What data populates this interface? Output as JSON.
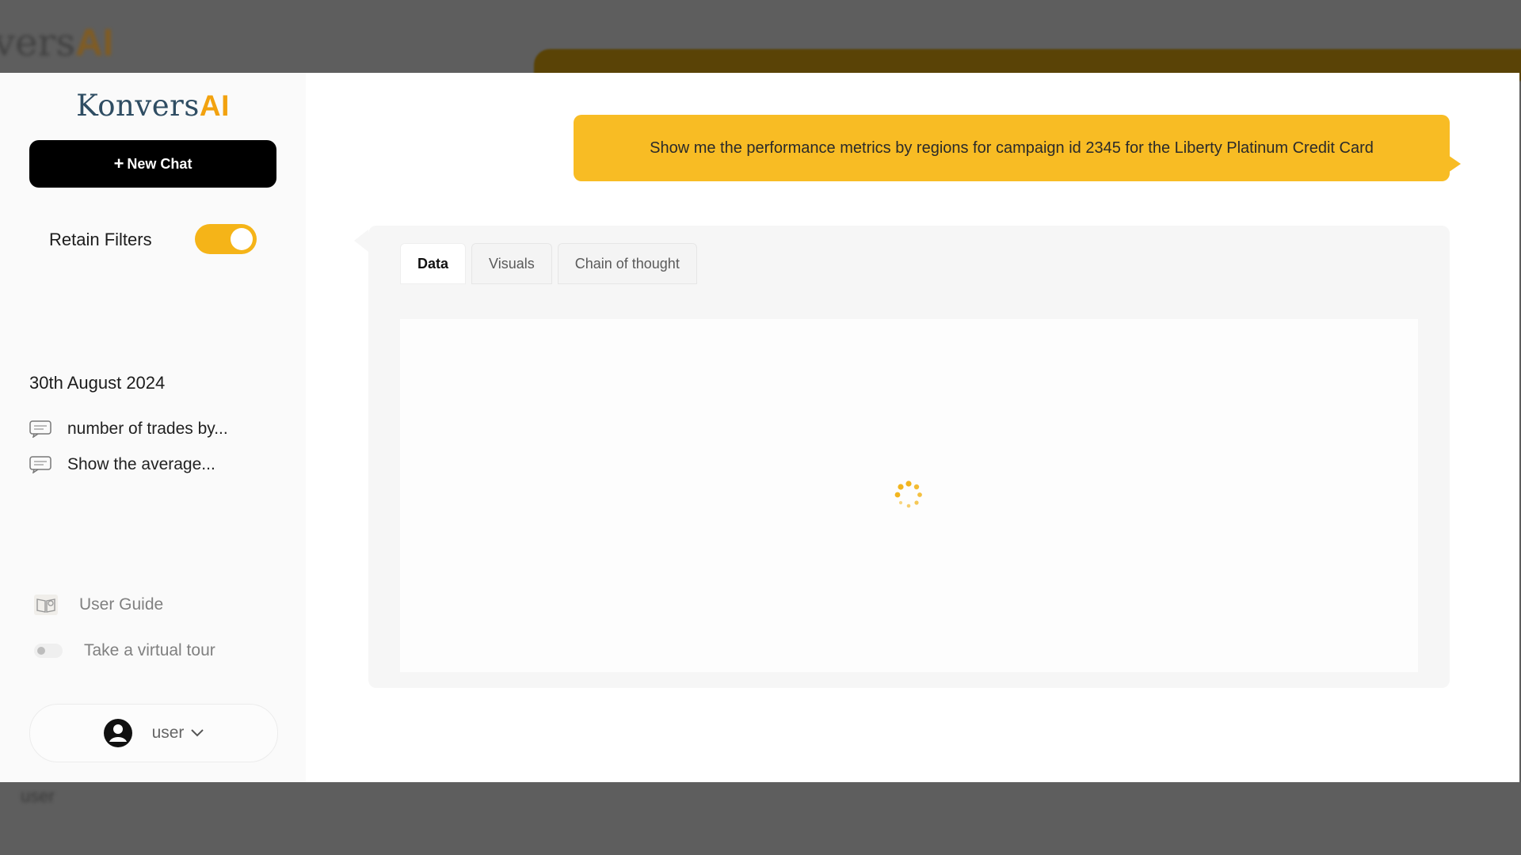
{
  "background": {
    "logo_main": "vers",
    "logo_accent": "AI",
    "user_label": "user"
  },
  "sidebar": {
    "logo": {
      "main": "Konvers",
      "accent": "AI"
    },
    "new_chat": {
      "icon": "plus-icon",
      "label": "New Chat"
    },
    "retain_filters": {
      "label": "Retain Filters",
      "enabled": true
    },
    "history": {
      "date": "30th August 2024",
      "items": [
        {
          "icon": "chat-bubble-icon",
          "label": "number of trades by..."
        },
        {
          "icon": "chat-bubble-icon",
          "label": "Show the average..."
        }
      ]
    },
    "user_guide": {
      "icon": "book-icon",
      "label": "User Guide"
    },
    "virtual_tour": {
      "label": "Take a virtual tour",
      "enabled": false
    },
    "user": {
      "icon": "user-avatar-icon",
      "name": "user",
      "chevron": "chevron-down-icon"
    }
  },
  "chat": {
    "user_message": "Show me the performance metrics by regions for campaign id 2345 for the Liberty Platinum Credit Card",
    "response": {
      "tabs": [
        {
          "label": "Data",
          "active": true
        },
        {
          "label": "Visuals",
          "active": false
        },
        {
          "label": "Chain of thought",
          "active": false
        }
      ],
      "status": "loading",
      "spinner_icon": "loading-spinner-icon"
    }
  },
  "colors": {
    "accent": "#f8bc24",
    "logo_text": "#2f4d63",
    "logo_accent": "#f2a20f",
    "overlay": "#5e5e5e"
  }
}
